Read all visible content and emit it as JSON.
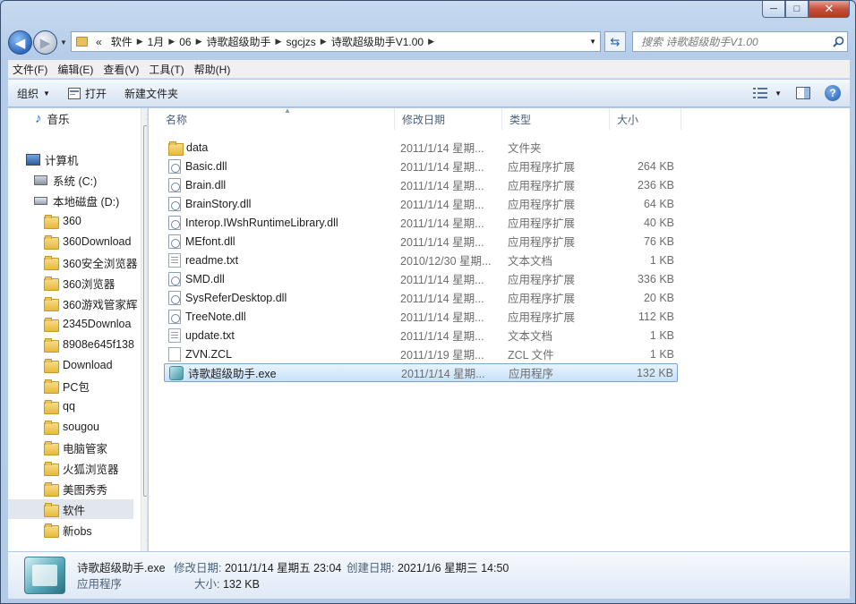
{
  "window": {
    "controls": {
      "minimize": "─",
      "maximize": "□",
      "close": "✕"
    }
  },
  "address": {
    "overflow": "«",
    "crumbs": [
      "软件",
      "1月",
      "06",
      "诗歌超级助手",
      "sgcjzs",
      "诗歌超级助手V1.00"
    ]
  },
  "search": {
    "placeholder": "搜索 诗歌超级助手V1.00"
  },
  "menu": [
    "文件(F)",
    "编辑(E)",
    "查看(V)",
    "工具(T)",
    "帮助(H)"
  ],
  "toolbar": {
    "organize": "组织",
    "open": "打开",
    "new_folder": "新建文件夹"
  },
  "nav_pane": {
    "music": "音乐",
    "computer": "计算机",
    "drive_c": "系统 (C:)",
    "drive_d": "本地磁盘 (D:)",
    "folders": [
      "360",
      "360Download",
      "360安全浏览器",
      "360浏览器",
      "360游戏管家辉",
      "2345Downloa",
      "8908e645f138",
      "Download",
      "PC包",
      "qq",
      "sougou",
      "电脑管家",
      "火狐浏览器",
      "美图秀秀",
      "软件",
      "新obs"
    ],
    "selected": "软件"
  },
  "columns": {
    "name": "名称",
    "date": "修改日期",
    "type": "类型",
    "size": "大小"
  },
  "files": [
    {
      "name": "data",
      "date": "2011/1/14 星期...",
      "type": "文件夹",
      "size": "",
      "icon": "folder-icon"
    },
    {
      "name": "Basic.dll",
      "date": "2011/1/14 星期...",
      "type": "应用程序扩展",
      "size": "264 KB",
      "icon": "dll-icon"
    },
    {
      "name": "Brain.dll",
      "date": "2011/1/14 星期...",
      "type": "应用程序扩展",
      "size": "236 KB",
      "icon": "dll-icon"
    },
    {
      "name": "BrainStory.dll",
      "date": "2011/1/14 星期...",
      "type": "应用程序扩展",
      "size": "64 KB",
      "icon": "dll-icon"
    },
    {
      "name": "Interop.IWshRuntimeLibrary.dll",
      "date": "2011/1/14 星期...",
      "type": "应用程序扩展",
      "size": "40 KB",
      "icon": "dll-icon"
    },
    {
      "name": "MEfont.dll",
      "date": "2011/1/14 星期...",
      "type": "应用程序扩展",
      "size": "76 KB",
      "icon": "dll-icon"
    },
    {
      "name": "readme.txt",
      "date": "2010/12/30 星期...",
      "type": "文本文档",
      "size": "1 KB",
      "icon": "text-file-icon"
    },
    {
      "name": "SMD.dll",
      "date": "2011/1/14 星期...",
      "type": "应用程序扩展",
      "size": "336 KB",
      "icon": "dll-icon"
    },
    {
      "name": "SysReferDesktop.dll",
      "date": "2011/1/14 星期...",
      "type": "应用程序扩展",
      "size": "20 KB",
      "icon": "dll-icon"
    },
    {
      "name": "TreeNote.dll",
      "date": "2011/1/14 星期...",
      "type": "应用程序扩展",
      "size": "112 KB",
      "icon": "dll-icon"
    },
    {
      "name": "update.txt",
      "date": "2011/1/14 星期...",
      "type": "文本文档",
      "size": "1 KB",
      "icon": "text-file-icon"
    },
    {
      "name": "ZVN.ZCL",
      "date": "2011/1/19 星期...",
      "type": "ZCL 文件",
      "size": "1 KB",
      "icon": "generic-file-icon"
    },
    {
      "name": "诗歌超级助手.exe",
      "date": "2011/1/14 星期...",
      "type": "应用程序",
      "size": "132 KB",
      "icon": "exe-icon",
      "selected": true
    }
  ],
  "details": {
    "name": "诗歌超级助手.exe",
    "type": "应用程序",
    "modified_label": "修改日期:",
    "modified": "2011/1/14 星期五 23:04",
    "created_label": "创建日期:",
    "created": "2021/1/6 星期三 14:50",
    "size_label": "大小:",
    "size": "132 KB"
  }
}
